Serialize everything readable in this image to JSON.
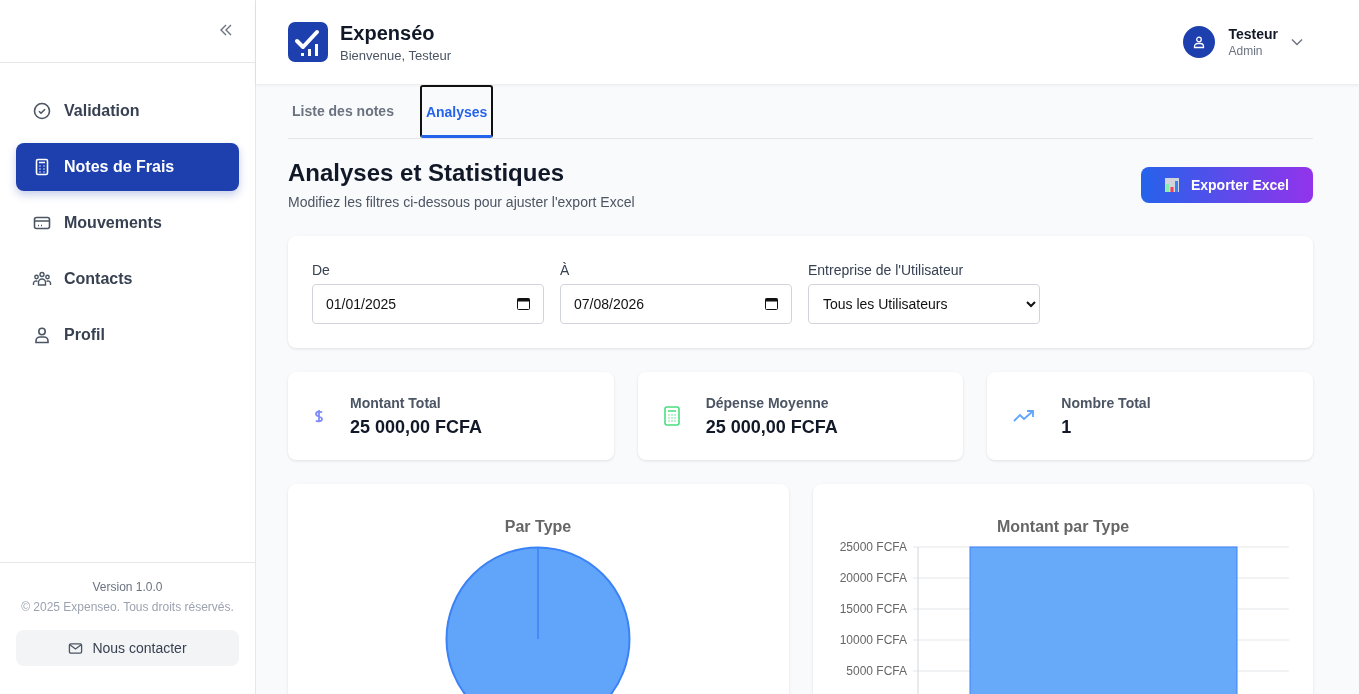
{
  "sidebar": {
    "items": [
      {
        "label": "Validation",
        "kind": "check",
        "selected": false
      },
      {
        "label": "Notes de Frais",
        "kind": "calculator",
        "selected": true
      },
      {
        "label": "Mouvements",
        "kind": "card",
        "selected": false
      },
      {
        "label": "Contacts",
        "kind": "group",
        "selected": false
      },
      {
        "label": "Profil",
        "kind": "user",
        "selected": false
      }
    ],
    "version": "Version 1.0.0",
    "copyright": "© 2025 Expenseo. Tous droits réservés.",
    "contact_button": "Nous contacter"
  },
  "header": {
    "app_name": "Expenséo",
    "welcome": "Bienvenue, Testeur",
    "user": {
      "name": "Testeur",
      "role": "Admin"
    }
  },
  "tabs": [
    {
      "label": "Liste des notes",
      "selected": false
    },
    {
      "label": "Analyses",
      "selected": true
    }
  ],
  "page": {
    "title": "Analyses et Statistiques",
    "subtitle": "Modifiez les filtres ci-dessous pour ajuster l'export Excel",
    "export_button": "Exporter Excel"
  },
  "filters": {
    "from": {
      "label": "De",
      "value": "01/01/2025"
    },
    "to": {
      "label": "À",
      "value": "07/08/2026"
    },
    "company": {
      "label": "Entreprise de l'Utilisateur",
      "value": "Tous les Utilisateurs"
    }
  },
  "stats": [
    {
      "kind": "amount",
      "label": "Montant Total",
      "value": "25 000,00 FCFA"
    },
    {
      "kind": "average",
      "label": "Dépense Moyenne",
      "value": "25 000,00 FCFA"
    },
    {
      "kind": "count",
      "label": "Nombre Total",
      "value": "1"
    }
  ],
  "pie_chart": {
    "title": "Par Type"
  },
  "bar_chart": {
    "chart_data": {
      "type": "bar",
      "title": "Montant par Type",
      "values": [
        25000
      ],
      "ylim": [
        0,
        25000
      ],
      "grid": true,
      "yticks": [
        {
          "value": 25000,
          "label": "25000 FCFA"
        },
        {
          "value": 20000,
          "label": "20000 FCFA"
        },
        {
          "value": 15000,
          "label": "15000 FCFA"
        },
        {
          "value": 10000,
          "label": "10000 FCFA"
        },
        {
          "value": 5000,
          "label": "5000 FCFA"
        }
      ]
    }
  }
}
